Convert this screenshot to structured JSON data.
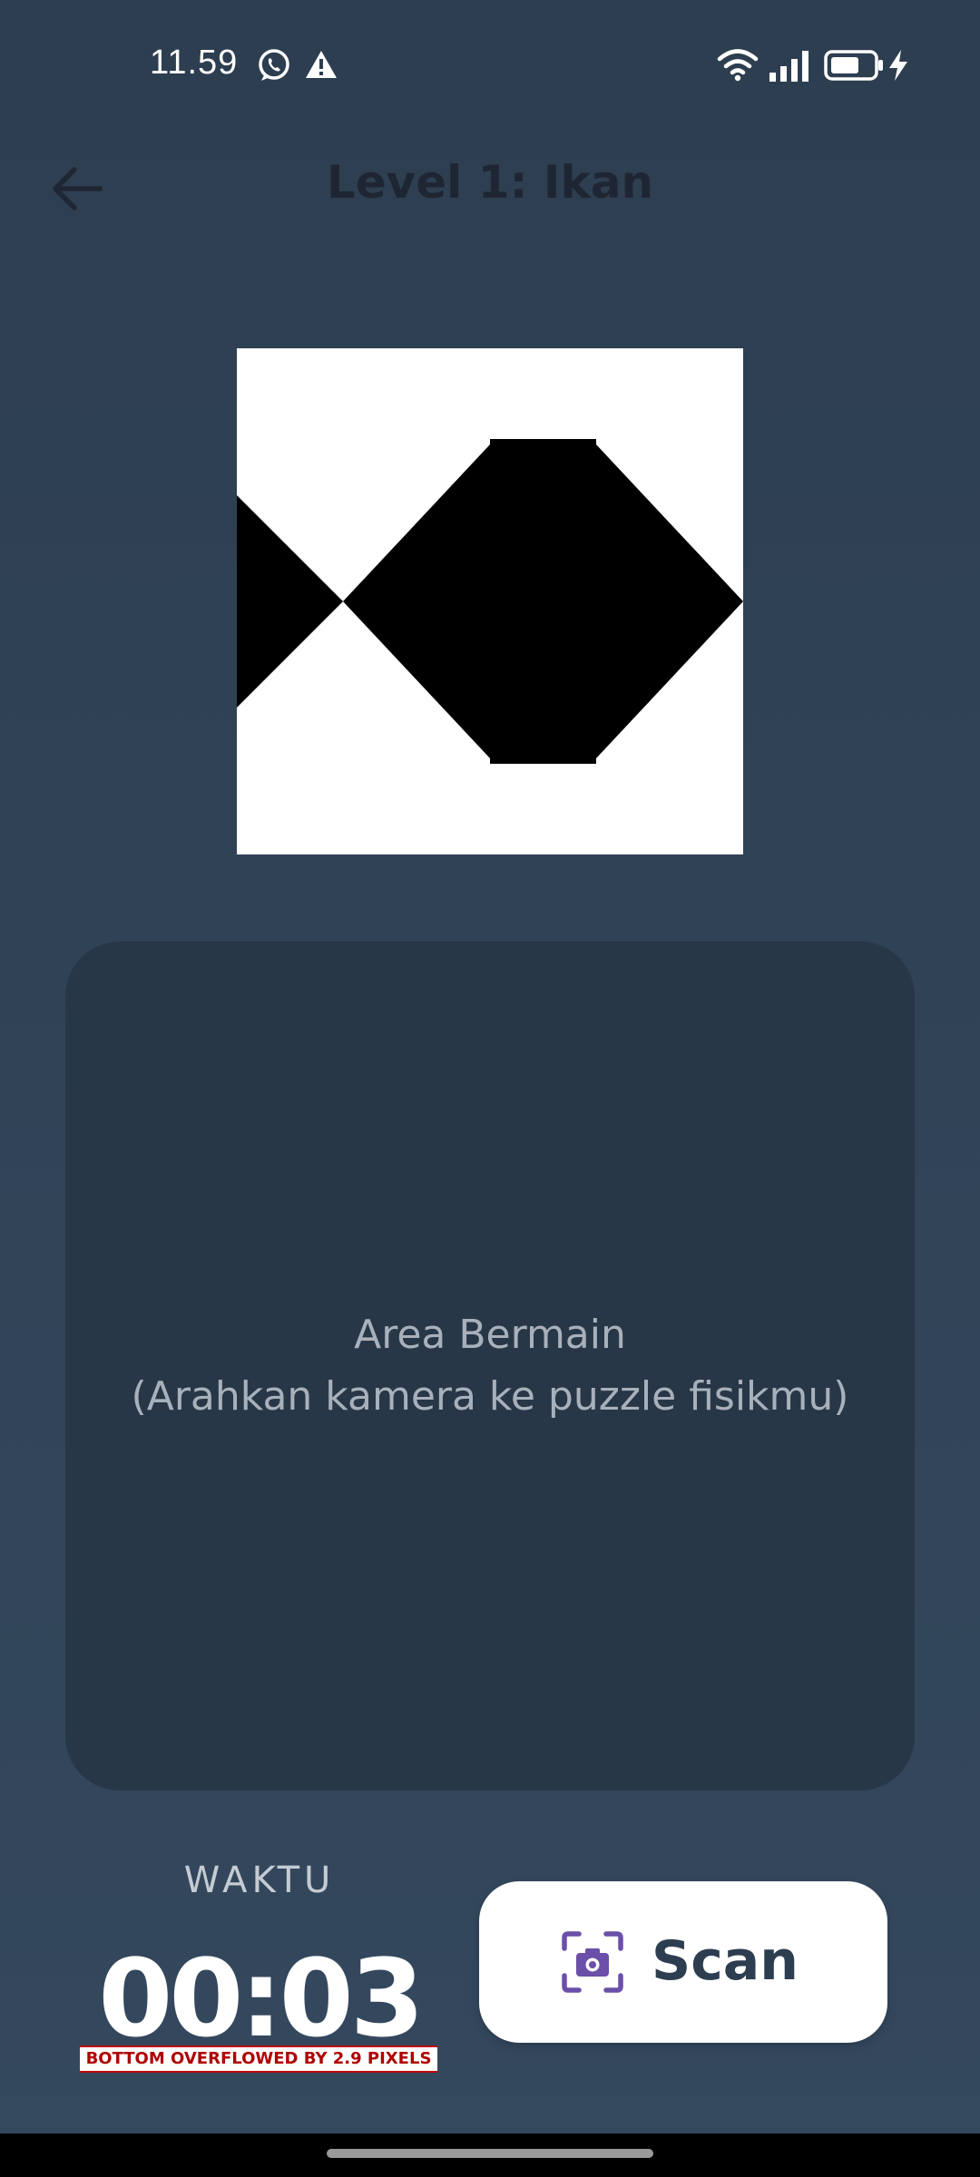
{
  "status_bar": {
    "time": "11.59",
    "icons": [
      "whatsapp-icon",
      "alert-icon",
      "wifi-icon",
      "signal-icon",
      "battery-icon",
      "charging-icon"
    ]
  },
  "header": {
    "back_icon": "arrow-left-icon",
    "title": "Level 1: Ikan"
  },
  "puzzle": {
    "image_icon": "fish-tangram-icon"
  },
  "play_area": {
    "line1": "Area Bermain",
    "line2": "(Arahkan kamera ke puzzle fisikmu)"
  },
  "timer": {
    "label": "WAKTU",
    "value": "00:03"
  },
  "debug": {
    "overflow_message": "BOTTOM OVERFLOWED BY 2.9 PIXELS"
  },
  "scan_button": {
    "label": "Scan",
    "icon": "camera-scan-icon",
    "icon_color": "#6b4fa8"
  },
  "colors": {
    "background": "#2d3e50",
    "play_area": "#283747",
    "title": "#1f2633",
    "button_text": "#2d3e50"
  }
}
